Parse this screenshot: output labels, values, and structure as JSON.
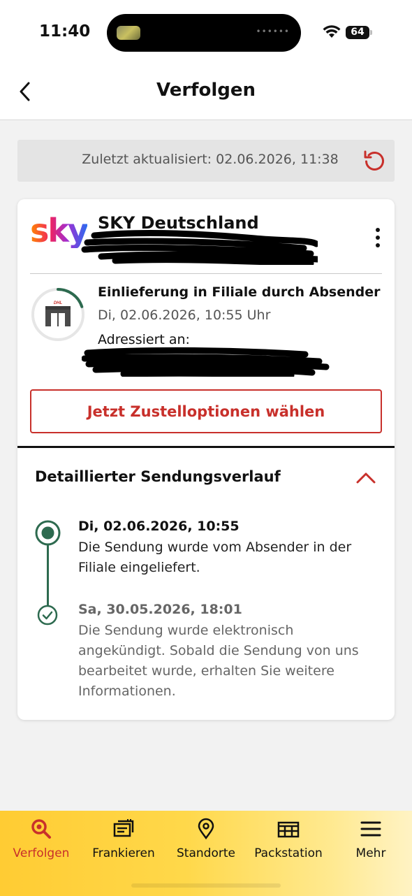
{
  "status_bar": {
    "time": "11:40",
    "battery": "64"
  },
  "header": {
    "title": "Verfolgen"
  },
  "refresh": {
    "label": "Zuletzt aktualisiert: 02.06.2026, 11:38"
  },
  "shipment": {
    "sender_logo": "sky",
    "sender_name": "SKY Deutschland",
    "status_title": "Einlieferung in Filiale durch Absender",
    "status_date": "Di, 02.06.2026, 10:55 Uhr",
    "addressed_label": "Adressiert an:",
    "progress_fraction": 0.2,
    "cta_label": "Jetzt Zustelloptionen wählen"
  },
  "history": {
    "title": "Detaillierter Sendungsverlauf",
    "events": [
      {
        "date": "Di, 02.06.2026, 10:55",
        "text": "Die Sendung wurde vom Absender in der Filiale eingeliefert."
      },
      {
        "date": "Sa, 30.05.2026, 18:01",
        "text": "Die Sendung wurde elektronisch angekündigt. Sobald die Sendung von uns bearbeitet wurde, erhalten Sie weitere Informationen."
      }
    ]
  },
  "nav": {
    "items": [
      {
        "label": "Verfolgen",
        "icon": "search-icon",
        "active": true
      },
      {
        "label": "Frankieren",
        "icon": "stamp-icon",
        "active": false
      },
      {
        "label": "Standorte",
        "icon": "location-pin-icon",
        "active": false
      },
      {
        "label": "Packstation",
        "icon": "packstation-icon",
        "active": false
      },
      {
        "label": "Mehr",
        "icon": "menu-icon",
        "active": false
      }
    ]
  },
  "colors": {
    "accent_red": "#c8302b",
    "timeline_green": "#2d6a4f",
    "nav_yellow": "#ffcc33"
  }
}
